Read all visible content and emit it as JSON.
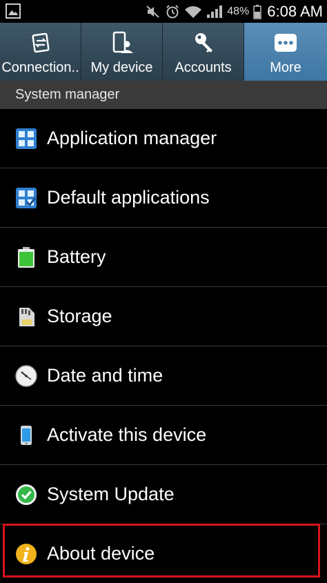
{
  "status_bar": {
    "battery_percent": "48%",
    "time": "6:08 AM",
    "icons": [
      "gallery-icon",
      "mute-icon",
      "alarm-icon",
      "wifi-icon",
      "signal-icon",
      "battery-icon"
    ]
  },
  "tabs": [
    {
      "label": "Connection..",
      "icon": "connections-icon",
      "active": false
    },
    {
      "label": "My device",
      "icon": "my-device-icon",
      "active": false
    },
    {
      "label": "Accounts",
      "icon": "key-icon",
      "active": false
    },
    {
      "label": "More",
      "icon": "more-icon",
      "active": true
    }
  ],
  "section": {
    "title": "System manager"
  },
  "items": [
    {
      "label": "Application manager",
      "icon": "grid-icon"
    },
    {
      "label": "Default applications",
      "icon": "grid-check-icon"
    },
    {
      "label": "Battery",
      "icon": "battery-icon"
    },
    {
      "label": "Storage",
      "icon": "sd-card-icon"
    },
    {
      "label": "Date and time",
      "icon": "clock-icon"
    },
    {
      "label": "Activate this device",
      "icon": "phone-icon"
    },
    {
      "label": "System Update",
      "icon": "check-circle-icon"
    },
    {
      "label": "About device",
      "icon": "info-icon"
    }
  ],
  "colors": {
    "active_tab": "#4a82ae",
    "tab_bg": "#34495a",
    "highlight_border": "#d8141c",
    "section_header_bg": "#3a3a3a"
  }
}
